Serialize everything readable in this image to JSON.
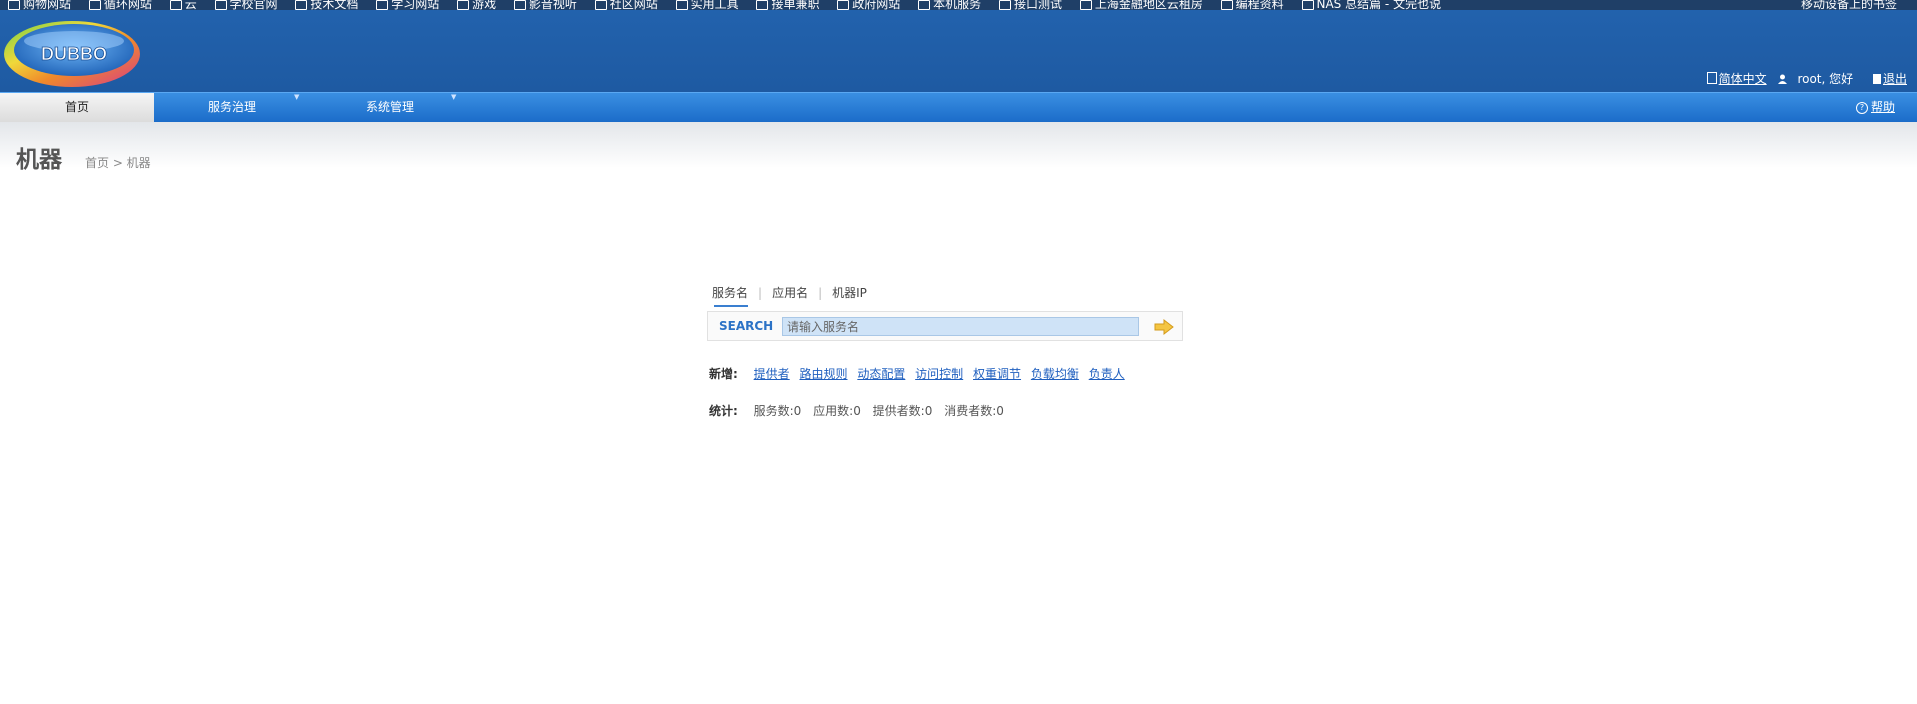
{
  "bookmarks": {
    "items": [
      "购物网站",
      "循环网站",
      "云",
      "学校官网",
      "技术文档",
      "学习网站",
      "游戏",
      "影音视听",
      "社区网站",
      "实用工具",
      "接单兼职",
      "政府网站",
      "本机服务",
      "接口测试",
      "上海金融地区云租房",
      "编程资料",
      "NAS 总结篇 - 文完也说"
    ],
    "right": "移动设备上的书签"
  },
  "header": {
    "logo_text": "DUBBO",
    "language": "简体中文",
    "greeting": "root, 您好",
    "logout": "退出"
  },
  "nav": {
    "tabs": [
      {
        "label": "首页",
        "active": true
      },
      {
        "label": "服务治理",
        "active": false
      },
      {
        "label": "系统管理",
        "active": false
      }
    ],
    "help": "帮助"
  },
  "page": {
    "title": "机器",
    "breadcrumb": "首页 > 机器"
  },
  "search": {
    "tabs": [
      "服务名",
      "应用名",
      "机器IP"
    ],
    "label": "SEARCH",
    "placeholder": "请输入服务名"
  },
  "new_links": {
    "label": "新增:",
    "items": [
      "提供者",
      "路由规则",
      "动态配置",
      "访问控制",
      "权重调节",
      "负载均衡",
      "负责人"
    ]
  },
  "stats": {
    "label": "统计:",
    "items": [
      "服务数:0",
      "应用数:0",
      "提供者数:0",
      "消费者数:0"
    ]
  },
  "colors": {
    "header": "#2262ad",
    "nav": "#2a7dd6",
    "link": "#1f5fbf",
    "search_input": "#cfe3f7"
  }
}
